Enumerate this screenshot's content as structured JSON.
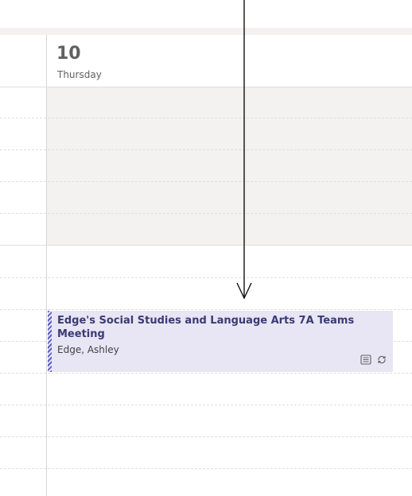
{
  "day_header": {
    "number": "10",
    "weekday": "Thursday"
  },
  "event": {
    "title": "Edge's Social Studies and Language Arts 7A Teams Meeting",
    "organizer": "Edge, Ashley",
    "icons": [
      "meeting-notes-icon",
      "recurring-icon"
    ]
  },
  "colors": {
    "event_background": "#e8e6f4",
    "event_stripe": "#5b5fc7",
    "off_hours": "#f3f2f1"
  }
}
